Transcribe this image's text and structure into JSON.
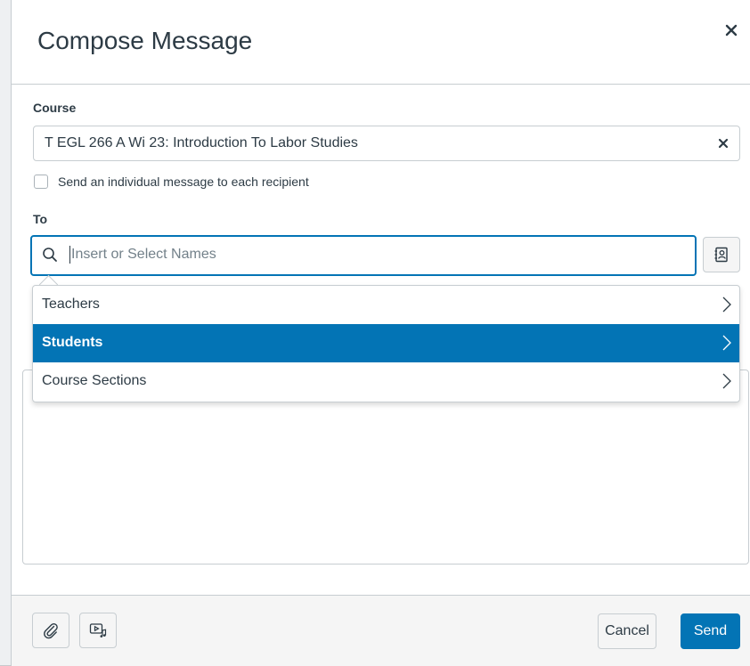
{
  "dialog": {
    "title": "Compose Message",
    "close_icon": "close-icon"
  },
  "course": {
    "label": "Course",
    "value": "T EGL 266 A Wi 23: Introduction To Labor Studies",
    "clear_icon": "clear-icon"
  },
  "individual_message": {
    "label": "Send an individual message to each recipient",
    "checked": false
  },
  "to": {
    "label": "To",
    "placeholder": "Insert or Select Names",
    "search_icon": "search-icon",
    "address_book_icon": "address-book-icon"
  },
  "recipient_menu": {
    "items": [
      {
        "label": "Teachers",
        "selected": false
      },
      {
        "label": "Students",
        "selected": true
      },
      {
        "label": "Course Sections",
        "selected": false
      }
    ]
  },
  "footer": {
    "attach_icon": "paperclip-icon",
    "media_icon": "media-icon",
    "cancel_label": "Cancel",
    "send_label": "Send"
  },
  "colors": {
    "accent": "#0374b5",
    "text": "#2d3b45",
    "border": "#c7cdd1",
    "placeholder": "#73818a"
  }
}
